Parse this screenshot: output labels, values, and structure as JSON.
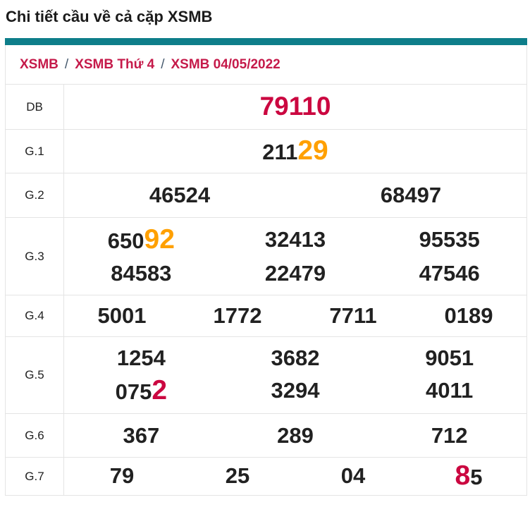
{
  "header": {
    "title": "Chi tiết cầu về cả cặp XSMB"
  },
  "breadcrumb": {
    "separator": "/",
    "items": [
      "XSMB",
      "XSMB Thứ 4",
      "XSMB 04/05/2022"
    ]
  },
  "colors": {
    "accent_teal": "#0e7e8a",
    "number_ink": "#212121",
    "highlight_red": "#cb0740",
    "highlight_orange": "#ffa000",
    "breadcrumb_red": "#c51a4a",
    "separator_slate": "#44586c",
    "border_gray": "#e4e4e4"
  },
  "table": {
    "rows": [
      {
        "label": "DB",
        "lines": [
          [
            [
              {
                "t": "79110",
                "c": "hl-db"
              }
            ]
          ]
        ]
      },
      {
        "label": "G.1",
        "lines": [
          [
            [
              {
                "t": "211"
              },
              {
                "t": "29",
                "c": "hl-orange"
              }
            ]
          ]
        ]
      },
      {
        "label": "G.2",
        "lines": [
          [
            [
              {
                "t": "46524"
              }
            ],
            [
              {
                "t": "68497"
              }
            ]
          ]
        ]
      },
      {
        "label": "G.3",
        "lines": [
          [
            [
              {
                "t": "650"
              },
              {
                "t": "92",
                "c": "hl-orange"
              }
            ],
            [
              {
                "t": "32413"
              }
            ],
            [
              {
                "t": "95535"
              }
            ]
          ],
          [
            [
              {
                "t": "84583"
              }
            ],
            [
              {
                "t": "22479"
              }
            ],
            [
              {
                "t": "47546"
              }
            ]
          ]
        ]
      },
      {
        "label": "G.4",
        "lines": [
          [
            [
              {
                "t": "5001"
              }
            ],
            [
              {
                "t": "1772"
              }
            ],
            [
              {
                "t": "7711"
              }
            ],
            [
              {
                "t": "0189"
              }
            ]
          ]
        ]
      },
      {
        "label": "G.5",
        "lines": [
          [
            [
              {
                "t": "1254"
              }
            ],
            [
              {
                "t": "3682"
              }
            ],
            [
              {
                "t": "9051"
              }
            ]
          ],
          [
            [
              {
                "t": "075"
              },
              {
                "t": "2",
                "c": "hl-red"
              }
            ],
            [
              {
                "t": "3294"
              }
            ],
            [
              {
                "t": "4011"
              }
            ]
          ]
        ]
      },
      {
        "label": "G.6",
        "lines": [
          [
            [
              {
                "t": "367"
              }
            ],
            [
              {
                "t": "289"
              }
            ],
            [
              {
                "t": "712"
              }
            ]
          ]
        ]
      },
      {
        "label": "G.7",
        "lines": [
          [
            [
              {
                "t": "79"
              }
            ],
            [
              {
                "t": "25"
              }
            ],
            [
              {
                "t": "04"
              }
            ],
            [
              {
                "t": "8",
                "c": "hl-red"
              },
              {
                "t": "5"
              }
            ]
          ]
        ]
      }
    ]
  }
}
